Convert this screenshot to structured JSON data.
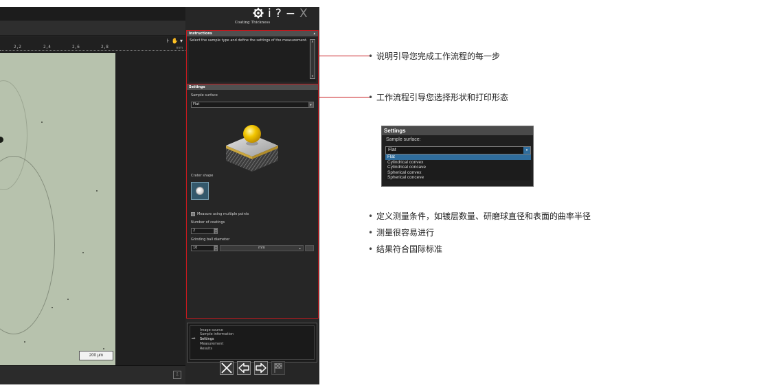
{
  "window": {
    "controls": [
      "gear-icon",
      "info-icon",
      "help-icon",
      "minimize-icon",
      "close-icon"
    ],
    "info_glyph": "i",
    "help_glyph": "?",
    "min_glyph": "−",
    "close_glyph": "X"
  },
  "ruler": {
    "ticks": [
      "2,2",
      "2,4",
      "2,6",
      "2,8"
    ],
    "unit": "mm",
    "tools": "⊦ ✋ ▾"
  },
  "image": {
    "scale_label": "200 µm"
  },
  "panel": {
    "title": "Coating Thickness",
    "instructions": {
      "heading": "Instructions",
      "text": "Select the sample type and define the settings of the measurement."
    },
    "settings": {
      "heading": "Settings",
      "sample_surface_label": "Sample surface",
      "sample_surface_value": "Flat",
      "crater_shape_label": "Crater shape",
      "multi_points_label": "Measure using multiple points",
      "coatings_label": "Number of coatings",
      "coatings_value": "2",
      "ball_label": "Grinding ball diameter",
      "ball_value": "10",
      "ball_unit": "mm"
    },
    "steps": [
      "Image source",
      "Sample information",
      "Settings",
      "Measurement",
      "Results"
    ],
    "active_step": "Settings",
    "nav_buttons": [
      "close-icon",
      "arrow-left-icon",
      "arrow-right-icon",
      "flag-icon"
    ]
  },
  "annotations": {
    "instructions_note": "说明引导您完成工作流程的每一步",
    "settings_note": "工作流程引导您选择形状和打印形态",
    "bullets": [
      "定义测量条件，如镀层数量、研磨球直径和表面的曲率半径",
      "测量很容易进行",
      "结果符合国际标准"
    ],
    "bullet_glyph": "•"
  },
  "inset": {
    "heading": "Settings",
    "label": "Sample surface:",
    "value": "Flat",
    "options": [
      "Flat",
      "Cylindrical convex",
      "Cylindrical concave",
      "Spherical convex",
      "Spherical conceve"
    ],
    "selected": "Flat"
  },
  "colors": {
    "highlight": "#c8191e",
    "panel_bg": "#262626",
    "select_blue": "#2f6d9d",
    "ball": "#f2c500",
    "microscope_bg": "#b7c2ad"
  }
}
